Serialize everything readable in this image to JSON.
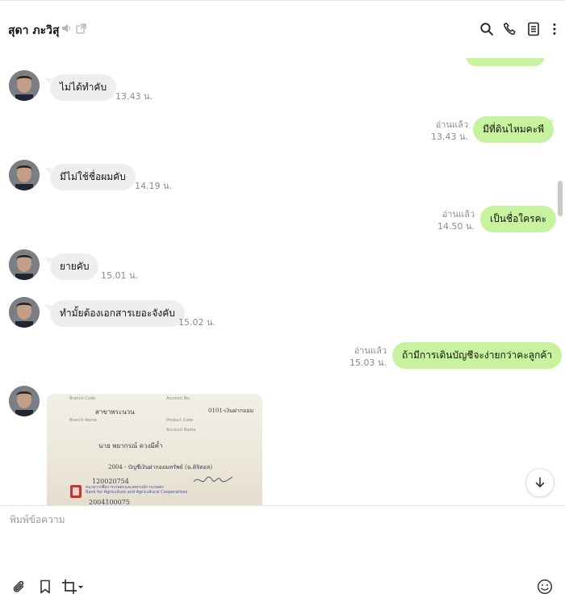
{
  "header": {
    "contact_name": "สุดา ภะวิสุ"
  },
  "messages": [
    {
      "direction": "in",
      "text": "ไม่ได้ทำคับ",
      "time": "13.43 น."
    },
    {
      "direction": "out",
      "text": "มีที่ดินไหมคะพี",
      "read": "อ่านแล้ว",
      "time": "13.43 น."
    },
    {
      "direction": "in",
      "text": "มีไม่ใช้ชื่อผมคับ",
      "time": "14.19 น."
    },
    {
      "direction": "out",
      "text": "เป็นชื่อใครคะ",
      "read": "อ่านแล้ว",
      "time": "14.50 น."
    },
    {
      "direction": "in",
      "text": "ยายคับ",
      "time": "15.01 น."
    },
    {
      "direction": "in",
      "text": "ทำมั้ยต้องเอกสารเยอะจังคับ",
      "time": "15.02 น."
    },
    {
      "direction": "out",
      "text": "ถ้ามีการเดินบัญชีจะง่ายกว่าคะลูกค้า",
      "read": "อ่านแล้ว",
      "time": "15.03 น."
    }
  ],
  "photo": {
    "line1": "สาขาพระนวน",
    "line2": "0101-เงินฝากออม",
    "line3": "นาย พยากรณ์ ดวงมีค้ำ",
    "line4": "2004 - บัญชีเงินฝากออมทรัพย์ (ฉ.ดิจิตอล)",
    "line5": "120020754",
    "line6": "2004100075"
  },
  "composer": {
    "placeholder": "พิมพ์ข้อความ"
  }
}
